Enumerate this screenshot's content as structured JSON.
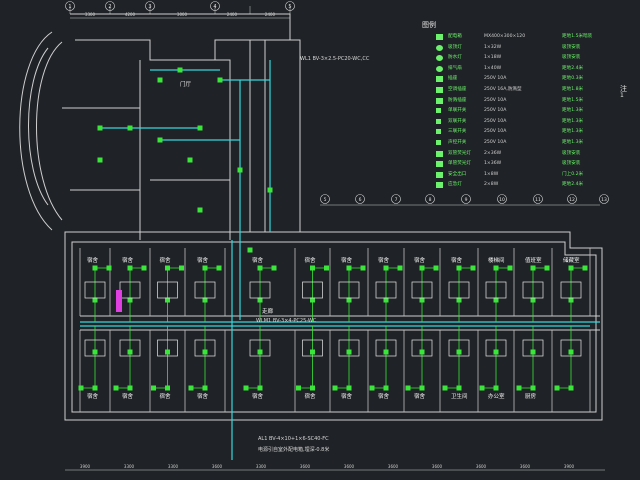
{
  "legend": {
    "title": "图例",
    "rows": [
      {
        "symbol": "distribution-box-icon",
        "name": "配电箱",
        "spec": "MX400×300×120",
        "note": "距地1.5米暗装"
      },
      {
        "symbol": "lamp-icon",
        "name": "吸顶灯",
        "spec": "1×32W",
        "note": "吸顶安装"
      },
      {
        "symbol": "lamp-icon",
        "name": "防水灯",
        "spec": "1×18W",
        "note": "吸顶安装"
      },
      {
        "symbol": "fan-icon",
        "name": "排气扇",
        "spec": "1×40W",
        "note": "距地2.4米"
      },
      {
        "symbol": "socket-icon",
        "name": "插座",
        "spec": "250V 10A",
        "note": "距地0.3米"
      },
      {
        "symbol": "socket-icon",
        "name": "空调插座",
        "spec": "250V 16A,防溅型",
        "note": "距地1.8米"
      },
      {
        "symbol": "socket-icon",
        "name": "防溅插座",
        "spec": "250V 10A",
        "note": "距地1.5米"
      },
      {
        "symbol": "switch-icon",
        "name": "单联开关",
        "spec": "250V 10A",
        "note": "距地1.3米"
      },
      {
        "symbol": "switch-icon",
        "name": "双联开关",
        "spec": "250V 10A",
        "note": "距地1.3米"
      },
      {
        "symbol": "switch-icon",
        "name": "三联开关",
        "spec": "250V 10A",
        "note": "距地1.3米"
      },
      {
        "symbol": "switch-icon",
        "name": "声控开关",
        "spec": "250V 10A",
        "note": "距地1.3米"
      },
      {
        "symbol": "fluorescent-icon",
        "name": "双管荧光灯",
        "spec": "2×36W",
        "note": "吸顶安装"
      },
      {
        "symbol": "fluorescent-icon",
        "name": "单管荧光灯",
        "spec": "1×36W",
        "note": "吸顶安装"
      },
      {
        "symbol": "exit-sign-icon",
        "name": "安全出口",
        "spec": "1×8W",
        "note": "门上0.2米"
      },
      {
        "symbol": "emergency-icon",
        "name": "应急灯",
        "spec": "2×8W",
        "note": "距地2.4米"
      }
    ],
    "colors": {
      "symbol": "#6cf26c",
      "text": "#cfcfcf"
    }
  },
  "side_notes": [
    "注",
    "1"
  ],
  "annotations": {
    "top_bus": "WL1 BV-3×2.5-PC20-WC,CC",
    "main_feeder": "WLM1 BV-3×4-PC25-WC",
    "bottom_feeder": "AL1 BV-4×10+1×6-SC40-FC",
    "bottom_note": "电源引自室外配电箱,埋深-0.8米",
    "corridor": "走廊",
    "entrance": "门厅"
  },
  "dimensions_top": [
    "3300",
    "4200",
    "3000",
    "2400",
    "2400"
  ],
  "dimensions_bottom": [
    "3900",
    "3300",
    "3300",
    "3600",
    "3300",
    "3600",
    "3600",
    "3600",
    "3600",
    "3600",
    "3600",
    "3900"
  ],
  "axis_top": [
    "1",
    "2",
    "3",
    "4",
    "5"
  ],
  "axis_right": [
    "5",
    "6",
    "7",
    "8",
    "9",
    "10",
    "11",
    "12",
    "13",
    "14",
    "15"
  ],
  "rooms": [
    "宿舍",
    "宿舍",
    "宿舍",
    "宿舍",
    "宿舍",
    "宿舍",
    "宿舍",
    "宿舍",
    "宿舍",
    "宿舍",
    "宿舍",
    "宿舍",
    "宿舍",
    "宿舍",
    "宿舍",
    "宿舍",
    "宿舍",
    "宿舍",
    "宿舍",
    "卫生间",
    "楼梯间",
    "办公室",
    "值班室",
    "厨房",
    "储藏室"
  ]
}
